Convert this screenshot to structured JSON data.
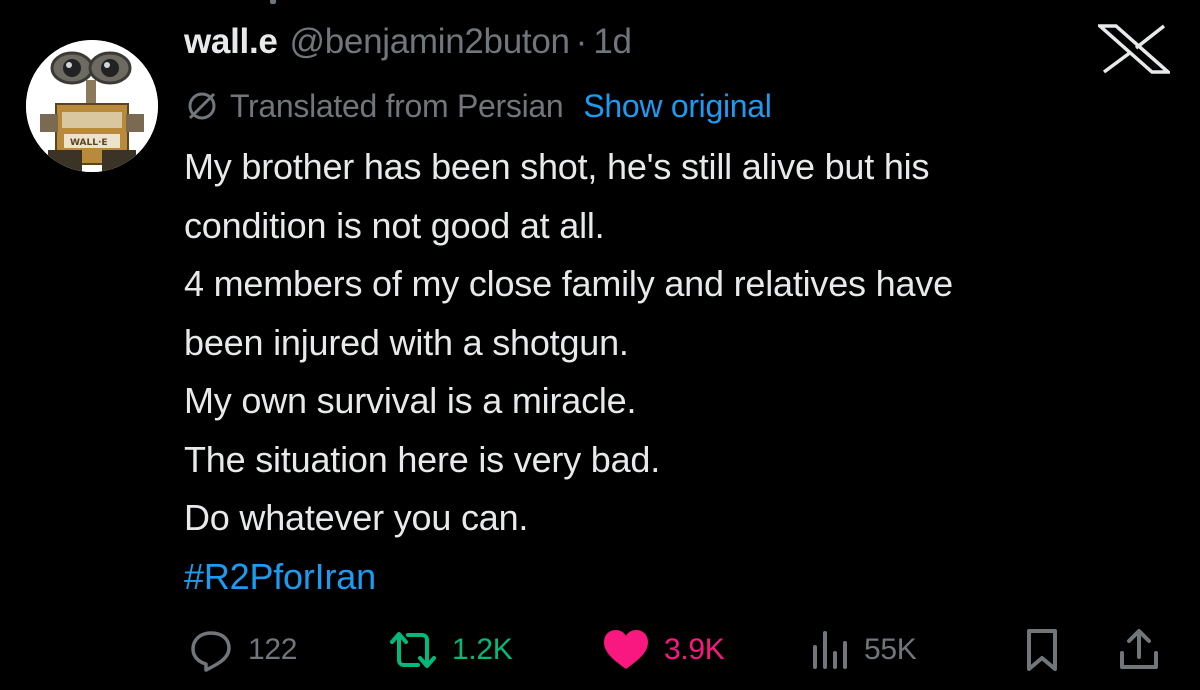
{
  "tweet": {
    "author": {
      "display_name": "wall.e",
      "handle": "@benjamin2buton",
      "separator": "·",
      "time": "1d",
      "avatar_icon": "wall-e-avatar",
      "avatar_text": "WALL·E"
    },
    "platform_icon": "x-logo-icon",
    "translation": {
      "icon": "globe-slash-icon",
      "label": "Translated from Persian",
      "action": "Show original"
    },
    "body_lines": [
      "My brother has been shot, he's still alive but his",
      "condition is not good at all.",
      "4 members of my close family and relatives have",
      "been injured with a shotgun.",
      "My own survival is a miracle.",
      "The situation here is very bad.",
      "Do whatever you can."
    ],
    "hashtag": "#R2PforIran",
    "actions": {
      "reply": {
        "icon": "reply-icon",
        "count": "122"
      },
      "repost": {
        "icon": "repost-icon",
        "count": "1.2K",
        "active": true
      },
      "like": {
        "icon": "heart-icon",
        "count": "3.9K",
        "active": true
      },
      "views": {
        "icon": "views-icon",
        "count": "55K"
      },
      "bookmark": {
        "icon": "bookmark-icon"
      },
      "share": {
        "icon": "share-icon"
      }
    }
  },
  "colors": {
    "background": "#000000",
    "text": "#e7e9ea",
    "muted": "#71767b",
    "link": "#1d9bf0",
    "repost": "#00ba7c",
    "like": "#f91880"
  }
}
